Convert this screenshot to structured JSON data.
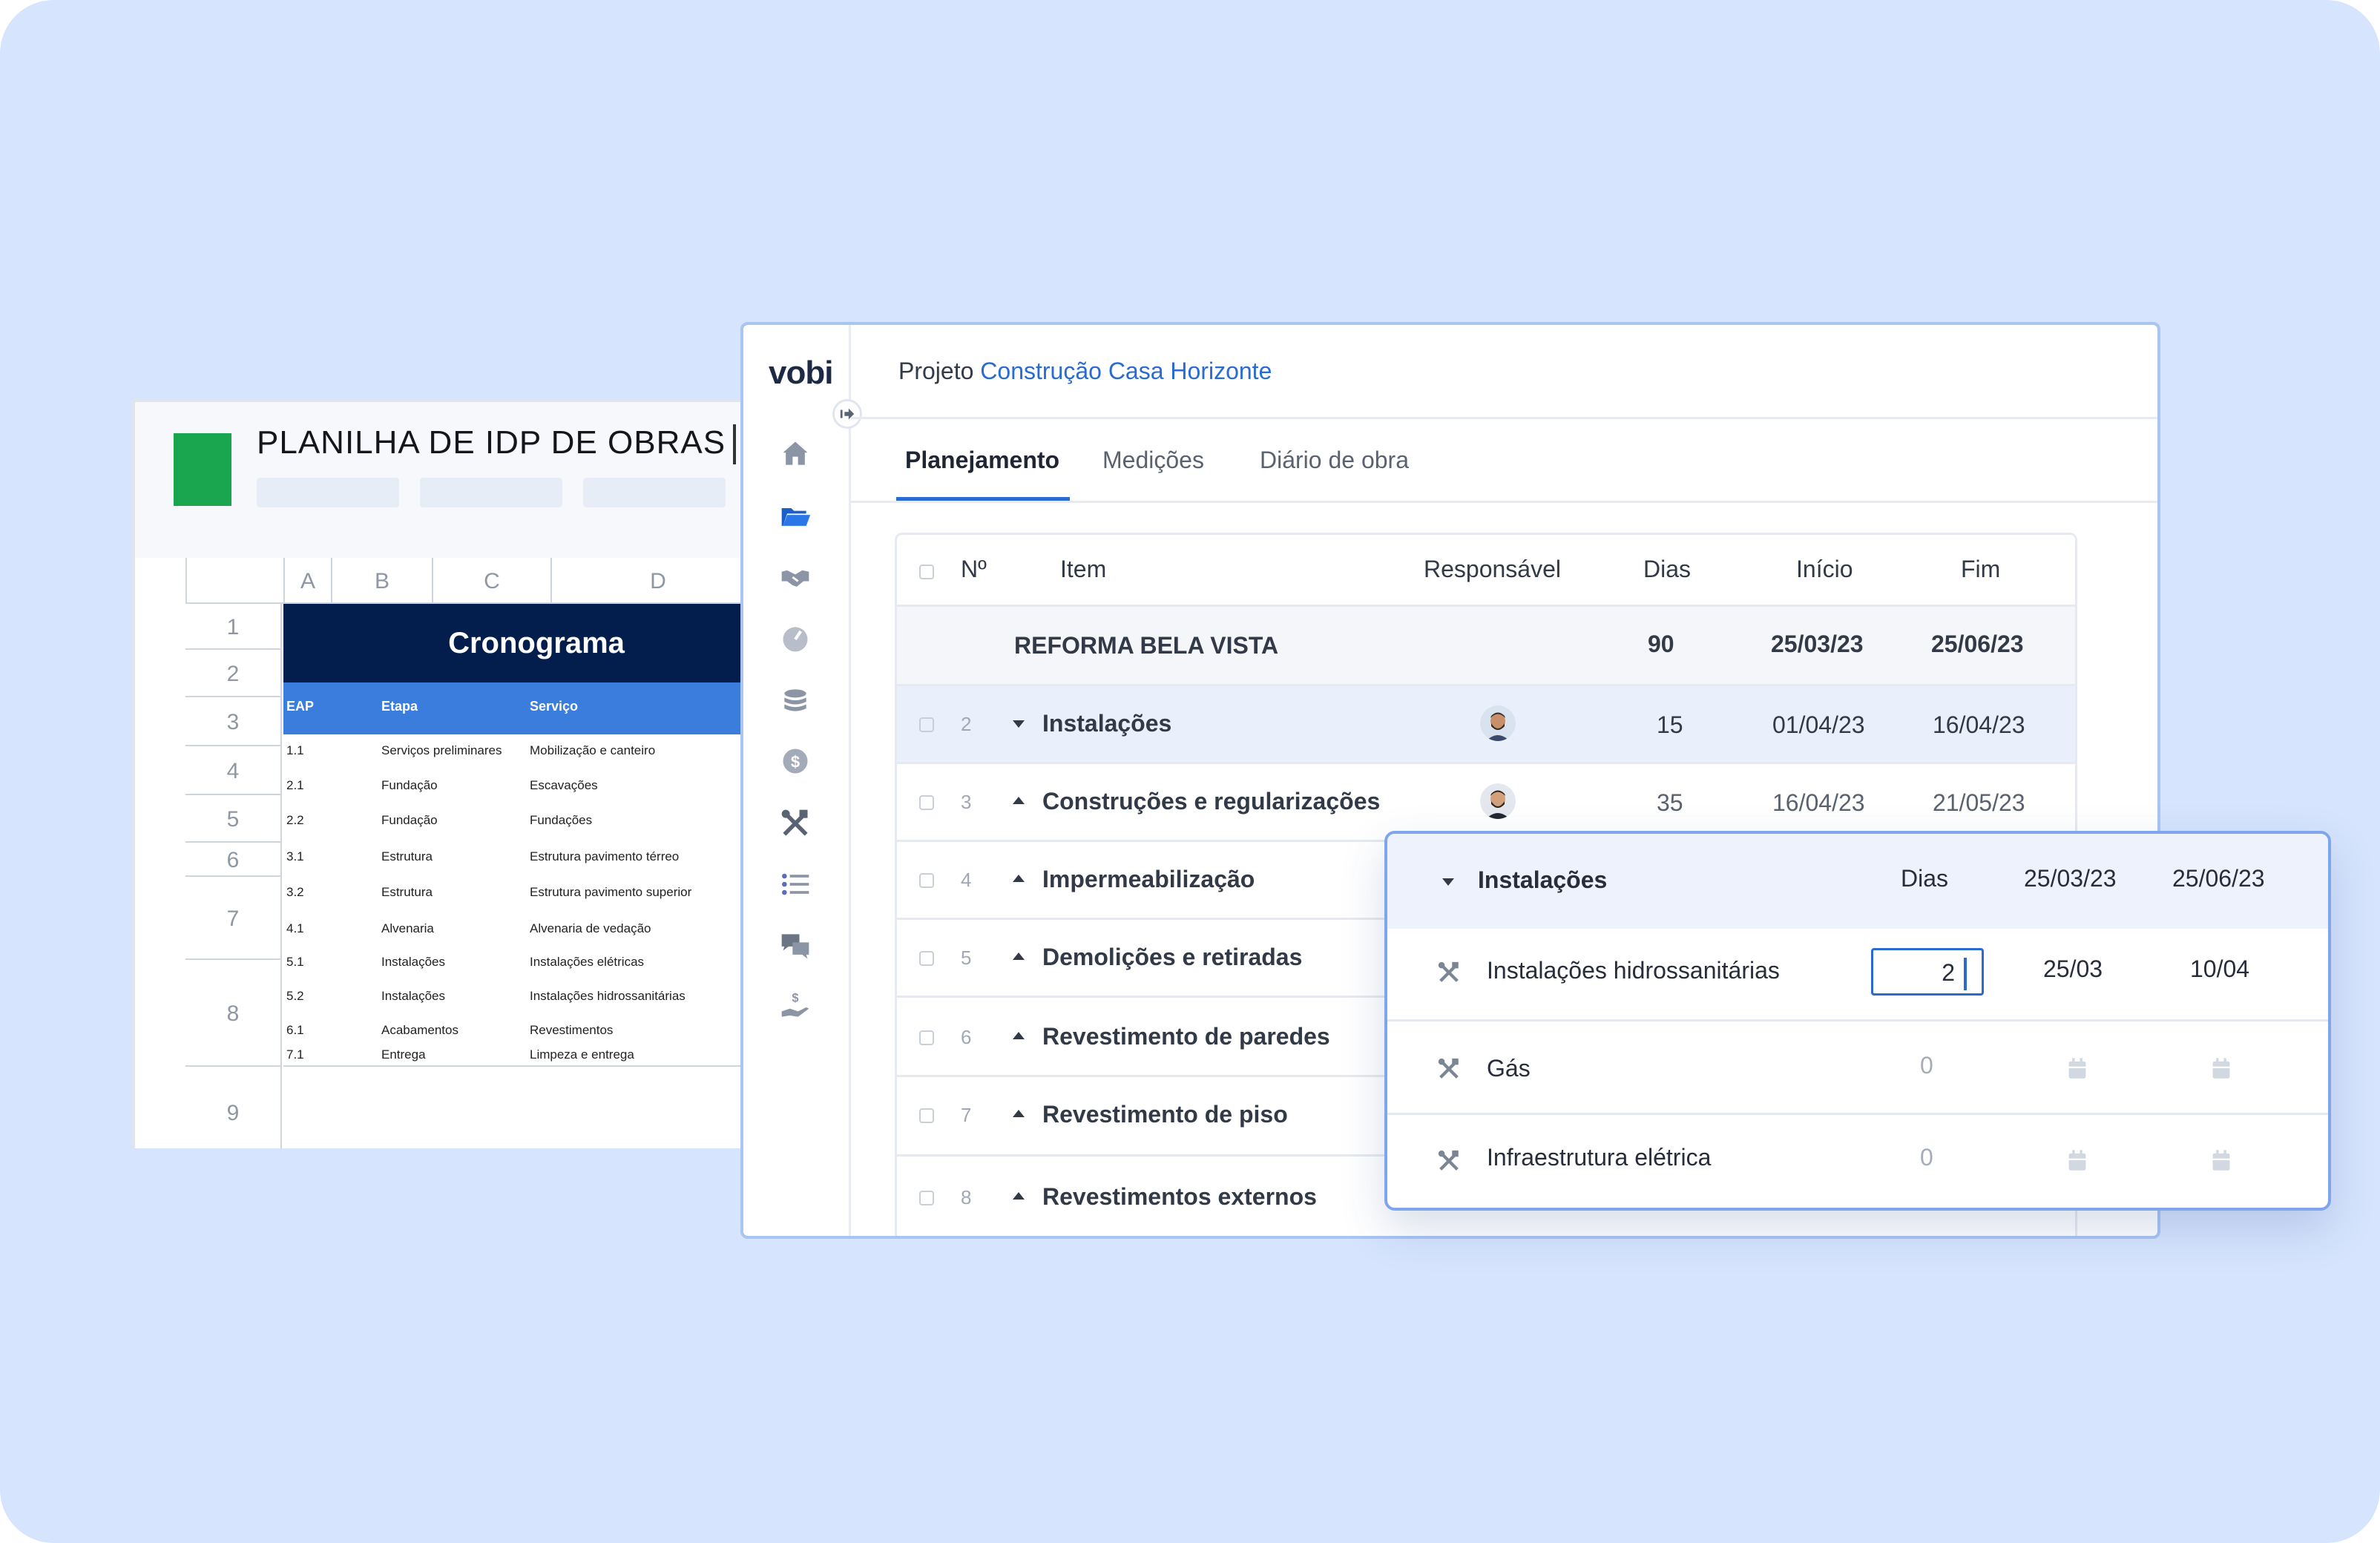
{
  "sheet": {
    "title": "PLANILHA DE IDP DE OBRAS",
    "columns": [
      "A",
      "B",
      "C",
      "D"
    ],
    "rows": [
      "1",
      "2",
      "3",
      "4",
      "5",
      "6",
      "7",
      "8",
      "9"
    ],
    "banner": "Cronograma",
    "headers": [
      "EAP",
      "Etapa",
      "Serviço"
    ],
    "data": [
      [
        "1.1",
        "Serviços preliminares",
        "Mobilização e canteiro"
      ],
      [
        "2.1",
        "Fundação",
        "Escavações"
      ],
      [
        "2.2",
        "Fundação",
        "Fundações"
      ],
      [
        "3.1",
        "Estrutura",
        "Estrutura pavimento térreo"
      ],
      [
        "3.2",
        "Estrutura",
        "Estrutura pavimento superior"
      ],
      [
        "4.1",
        "Alvenaria",
        "Alvenaria de vedação"
      ],
      [
        "5.1",
        "Instalações",
        "Instalações elétricas"
      ],
      [
        "5.2",
        "Instalações",
        "Instalações hidrossanitárias"
      ],
      [
        "6.1",
        "Acabamentos",
        "Revestimentos"
      ],
      [
        "7.1",
        "Entrega",
        "Limpeza e entrega"
      ]
    ],
    "colors": {
      "logo": "#1aa64e",
      "banner": "#031e4c",
      "band": "#3b7ddd"
    }
  },
  "app": {
    "logo": "vobi",
    "project_prefix": "Projeto",
    "project_name": "Construção Casa Horizonte",
    "tabs": [
      "Planejamento",
      "Medições",
      "Diário de obra"
    ],
    "active_tab": "Planejamento",
    "sidebar_icons": [
      "home-icon",
      "folder-icon",
      "handshake-icon",
      "dashboard-icon",
      "coins-icon",
      "dollar-icon",
      "tools-icon",
      "list-icon",
      "chat-icon",
      "payment-icon"
    ],
    "accent": "#2a6bd1"
  },
  "table": {
    "headers": {
      "num": "Nº",
      "item": "Item",
      "responsavel": "Responsável",
      "dias": "Dias",
      "inicio": "Início",
      "fim": "Fim"
    },
    "summary": {
      "item": "REFORMA BELA VISTA",
      "dias": "90",
      "inicio": "25/03/23",
      "fim": "25/06/23"
    },
    "rows": [
      {
        "num": "2",
        "item": "Instalações",
        "dias": "15",
        "inicio": "01/04/23",
        "fim": "16/04/23",
        "expanded": true
      },
      {
        "num": "3",
        "item": "Construções e regularizações",
        "dias": "35",
        "inicio": "16/04/23",
        "fim": "21/05/23",
        "expanded": false
      },
      {
        "num": "4",
        "item": "Impermeabilização"
      },
      {
        "num": "5",
        "item": "Demolições e retiradas"
      },
      {
        "num": "6",
        "item": "Revestimento de paredes"
      },
      {
        "num": "7",
        "item": "Revestimento de piso"
      },
      {
        "num": "8",
        "item": "Revestimentos externos"
      }
    ]
  },
  "popup": {
    "header": {
      "item": "Instalações",
      "dias": "Dias",
      "inicio": "25/03/23",
      "fim": "25/06/23"
    },
    "rows": [
      {
        "item": "Instalações hidrossanitárias",
        "dias": "2",
        "inicio": "25/03",
        "fim": "10/04"
      },
      {
        "item": "Gás",
        "dias": "0"
      },
      {
        "item": "Infraestrutura elétrica",
        "dias": "0"
      }
    ]
  }
}
